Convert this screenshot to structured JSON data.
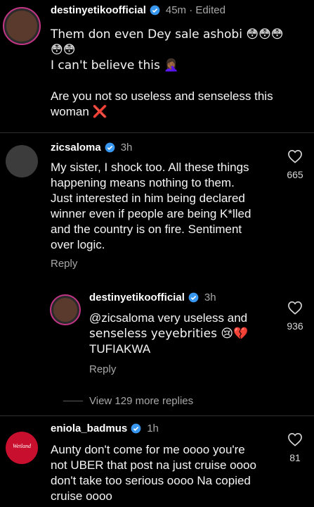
{
  "comments": [
    {
      "username": "destinyetikoofficial",
      "time": "45m · Edited",
      "line1": "Them don even Dey sale ashobi 😳😳😳",
      "line2": "😳😳",
      "line3": "I can't believe this 🤦🏾‍♀️",
      "line4": "Are you not so useless and senseless this",
      "line5": "woman",
      "x_mark": "❌"
    },
    {
      "username": "zicsaloma",
      "time": "3h",
      "lines": [
        "My sister, I shock too. All these things",
        "happening means nothing to them.",
        "Just interested in him being declared",
        "winner even if people are being K*lled",
        "and the country is on fire. Sentiment",
        "over logic."
      ],
      "reply_label": "Reply",
      "likes": "665"
    },
    {
      "username": "destinyetikoofficial",
      "time": "3h",
      "lines": [
        "@zicsaloma very useless and",
        "senseless yeyebrities 😢💔",
        "TUFIAKWA"
      ],
      "reply_label": "Reply",
      "likes": "936"
    },
    {
      "username": "eniola_badmus",
      "time": "1h",
      "avatar_text": "Wetland",
      "lines": [
        "Aunty don't come for me oooo you're",
        "not UBER that post na just cruise oooo",
        "don't take too serious oooo Na copied",
        "cruise oooo"
      ],
      "likes": "81"
    }
  ],
  "view_more": "View 129 more replies",
  "colors": {
    "verified": "#3897f0",
    "story_ring": "#c13584",
    "secondary_text": "#a8a8a8"
  },
  "icons": [
    "verified-badge-icon",
    "heart-icon"
  ]
}
